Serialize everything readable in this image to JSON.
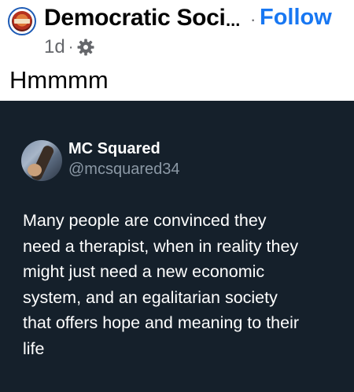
{
  "post": {
    "page_name": "Democratic Soci",
    "name_ellipsis": "...",
    "separator": "·",
    "follow_label": "Follow",
    "timestamp": "1d",
    "meta_separator": "·",
    "audience_icon": "gear-icon",
    "text": "Hmmmm"
  },
  "tweet": {
    "author_name": "MC Squared",
    "handle": "@mcsquared34",
    "body_lines": [
      "Many people are convinced they",
      "need a therapist, when in reality they",
      "might just need a new economic",
      "system, and an egalitarian society",
      "that offers hope and meaning to their",
      "life"
    ]
  },
  "colors": {
    "follow": "#1877f2",
    "tweet_background": "#15202b",
    "handle": "#8b98a5",
    "meta": "#65676b"
  }
}
